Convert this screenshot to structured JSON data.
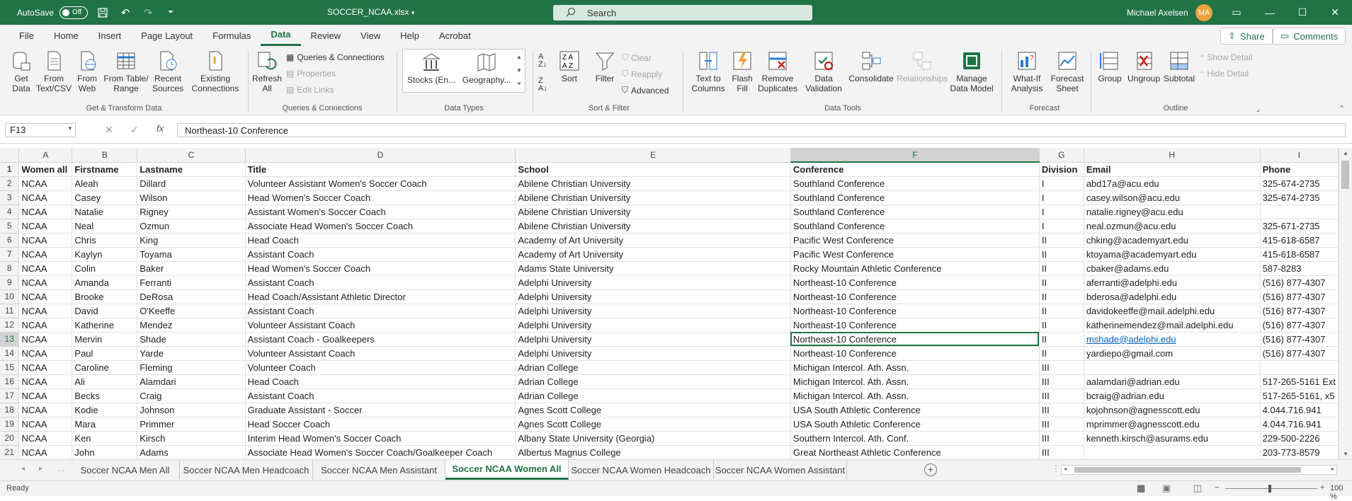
{
  "titlebar": {
    "autosave_label": "AutoSave",
    "autosave_state": "Off",
    "filename": "SOCCER_NCAA.xlsx",
    "search_placeholder": "Search",
    "user_name": "Michael Axelsen",
    "user_initials": "MA"
  },
  "menu": {
    "tabs": [
      "File",
      "Home",
      "Insert",
      "Page Layout",
      "Formulas",
      "Data",
      "Review",
      "View",
      "Help",
      "Acrobat"
    ],
    "active_tab": "Data",
    "share_label": "Share",
    "comments_label": "Comments"
  },
  "ribbon": {
    "get_data": "Get Data",
    "from_text_csv": "From Text/CSV",
    "from_web": "From Web",
    "from_table_range": "From Table/ Range",
    "recent_sources": "Recent Sources",
    "existing_connections": "Existing Connections",
    "group_get_transform": "Get & Transform Data",
    "refresh_all": "Refresh All",
    "queries_connections": "Queries & Connections",
    "properties": "Properties",
    "edit_links": "Edit Links",
    "group_queries": "Queries & Connections",
    "stocks": "Stocks (En...",
    "geography": "Geography...",
    "group_data_types": "Data Types",
    "sort": "Sort",
    "filter": "Filter",
    "clear": "Clear",
    "reapply": "Reapply",
    "advanced": "Advanced",
    "group_sort_filter": "Sort & Filter",
    "text_to_columns": "Text to Columns",
    "flash_fill": "Flash Fill",
    "remove_duplicates": "Remove Duplicates",
    "data_validation": "Data Validation",
    "consolidate": "Consolidate",
    "relationships": "Relationships",
    "manage_data_model": "Manage Data Model",
    "group_data_tools": "Data Tools",
    "what_if": "What-If Analysis",
    "forecast_sheet": "Forecast Sheet",
    "group_forecast": "Forecast",
    "group": "Group",
    "ungroup": "Ungroup",
    "subtotal": "Subtotal",
    "show_detail": "Show Detail",
    "hide_detail": "Hide Detail",
    "group_outline": "Outline"
  },
  "formula_bar": {
    "name_box": "F13",
    "formula": "Northeast-10 Conference"
  },
  "grid": {
    "columns": [
      "A",
      "B",
      "C",
      "D",
      "E",
      "F",
      "G",
      "H",
      "I"
    ],
    "rows": [
      {
        "n": "1",
        "cells": [
          "Women all",
          "Firstname",
          "Lastname",
          "Title",
          "School",
          "Conference",
          "Division",
          "Email",
          "Phone"
        ]
      },
      {
        "n": "2",
        "cells": [
          "NCAA",
          "Aleah",
          "Dillard",
          "Volunteer Assistant Women's Soccer Coach",
          "Abilene Christian University",
          "Southland Conference",
          "I",
          "abd17a@acu.edu",
          "325-674-2735"
        ]
      },
      {
        "n": "3",
        "cells": [
          "NCAA",
          "Casey",
          "Wilson",
          "Head Women's Soccer Coach",
          "Abilene Christian University",
          "Southland Conference",
          "I",
          "casey.wilson@acu.edu",
          "325-674-2735"
        ]
      },
      {
        "n": "4",
        "cells": [
          "NCAA",
          "Natalie",
          "Rigney",
          "Assistant Women's Soccer Coach",
          "Abilene Christian University",
          "Southland Conference",
          "I",
          "natalie.rigney@acu.edu",
          ""
        ]
      },
      {
        "n": "5",
        "cells": [
          "NCAA",
          "Neal",
          "Ozmun",
          "Associate Head Women's Soccer Coach",
          "Abilene Christian University",
          "Southland Conference",
          "I",
          "neal.ozmun@acu.edu",
          "325-671-2735"
        ]
      },
      {
        "n": "6",
        "cells": [
          "NCAA",
          "Chris",
          "King",
          "Head Coach",
          "Academy of Art University",
          "Pacific West Conference",
          "II",
          "chking@academyart.edu",
          "415-618-6587"
        ]
      },
      {
        "n": "7",
        "cells": [
          "NCAA",
          "Kaylyn",
          "Toyama",
          "Assistant Coach",
          "Academy of Art University",
          "Pacific West Conference",
          "II",
          "ktoyama@academyart.edu",
          "415-618-6587"
        ]
      },
      {
        "n": "8",
        "cells": [
          "NCAA",
          "Colin",
          "Baker",
          "Head Women's Soccer Coach",
          "Adams State University",
          "Rocky Mountain Athletic Conference",
          "II",
          "cbaker@adams.edu",
          "587-8283"
        ]
      },
      {
        "n": "9",
        "cells": [
          "NCAA",
          "Amanda",
          "Ferranti",
          "Assistant Coach",
          "Adelphi University",
          "Northeast-10 Conference",
          "II",
          "aferranti@adelphi.edu",
          "(516) 877-4307"
        ]
      },
      {
        "n": "10",
        "cells": [
          "NCAA",
          "Brooke",
          "DeRosa",
          "Head Coach/Assistant Athletic Director",
          "Adelphi University",
          "Northeast-10 Conference",
          "II",
          "bderosa@adelphi.edu",
          "(516) 877-4307"
        ]
      },
      {
        "n": "11",
        "cells": [
          "NCAA",
          "David",
          "O'Keeffe",
          "Assistant Coach",
          "Adelphi University",
          "Northeast-10 Conference",
          "II",
          "davidokeeffe@mail.adelphi.edu",
          "(516) 877-4307"
        ]
      },
      {
        "n": "12",
        "cells": [
          "NCAA",
          "Katherine",
          "Mendez",
          "Volunteer Assistant Coach",
          "Adelphi University",
          "Northeast-10 Conference",
          "II",
          "katherinemendez@mail.adelphi.edu",
          "(516) 877-4307"
        ]
      },
      {
        "n": "13",
        "cells": [
          "NCAA",
          "Mervin",
          "Shade",
          "Assistant Coach - Goalkeepers",
          "Adelphi University",
          "Northeast-10 Conference",
          "II",
          "mshade@adelphi.edu",
          "(516) 877-4307"
        ]
      },
      {
        "n": "14",
        "cells": [
          "NCAA",
          "Paul",
          "Yarde",
          "Volunteer Assistant Coach",
          "Adelphi University",
          "Northeast-10 Conference",
          "II",
          "yardiepo@gmail.com",
          "(516) 877-4307"
        ]
      },
      {
        "n": "15",
        "cells": [
          "NCAA",
          "Caroline",
          "Fleming",
          "Volunteer Coach",
          "Adrian College",
          "Michigan Intercol. Ath. Assn.",
          "III",
          "",
          ""
        ]
      },
      {
        "n": "16",
        "cells": [
          "NCAA",
          "Ali",
          "Alamdari",
          "Head Coach",
          "Adrian College",
          "Michigan Intercol. Ath. Assn.",
          "III",
          "aalamdari@adrian.edu",
          "517-265-5161 Ext"
        ]
      },
      {
        "n": "17",
        "cells": [
          "NCAA",
          "Becks",
          "Craig",
          "Assistant Coach",
          "Adrian College",
          "Michigan Intercol. Ath. Assn.",
          "III",
          "bcraig@adrian.edu",
          "517-265-5161, x5"
        ]
      },
      {
        "n": "18",
        "cells": [
          "NCAA",
          "Kodie",
          "Johnson",
          "Graduate Assistant - Soccer",
          "Agnes Scott College",
          "USA South Athletic Conference",
          "III",
          "kojohnson@agnesscott.edu",
          "4.044.716.941"
        ]
      },
      {
        "n": "19",
        "cells": [
          "NCAA",
          "Mara",
          "Primmer",
          "Head Soccer Coach",
          "Agnes Scott College",
          "USA South Athletic Conference",
          "III",
          "mprimmer@agnesscott.edu",
          "4.044.716.941"
        ]
      },
      {
        "n": "20",
        "cells": [
          "NCAA",
          "Ken",
          "Kirsch",
          "Interim Head Women's Soccer Coach",
          "Albany State University (Georgia)",
          "Southern Intercol. Ath. Conf.",
          "III",
          "kenneth.kirsch@asurams.edu",
          "229-500-2226"
        ]
      },
      {
        "n": "21",
        "cells": [
          "NCAA",
          "John",
          "Adams",
          "Associate Head Women's Soccer Coach/Goalkeeper Coach",
          "Albertus Magnus College",
          "Great Northeast Athletic Conference",
          "III",
          "",
          "203-773-8579"
        ]
      }
    ]
  },
  "sheets": {
    "tabs": [
      "Soccer NCAA Men All",
      "Soccer NCAA Men Headcoach",
      "Soccer NCAA Men Assistant",
      "Soccer NCAA Women All",
      "Soccer NCAA Women Headcoach",
      "Soccer NCAA Women Assistant"
    ],
    "active": "Soccer NCAA Women All"
  },
  "status": {
    "text": "Ready",
    "zoom": "100 %"
  },
  "colors": {
    "brand": "#217346",
    "link": "#0563c1"
  }
}
